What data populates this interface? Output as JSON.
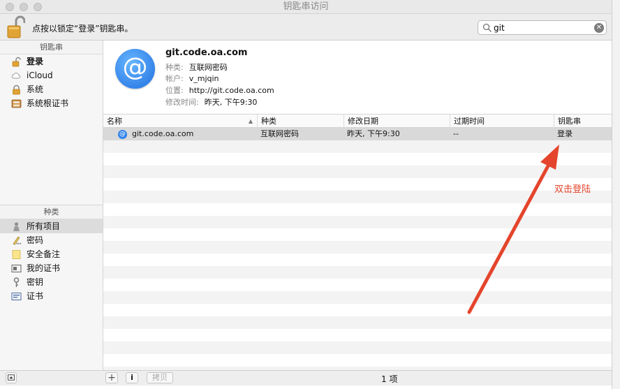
{
  "window": {
    "title": "钥匙串访问"
  },
  "toolbar": {
    "lock_hint": "点按以锁定“登录”钥匙串。",
    "search": {
      "value": "git"
    }
  },
  "sidebar": {
    "keychains_header": "钥匙串",
    "keychains": [
      {
        "label": "登录",
        "icon": "lock-icon",
        "bold": true
      },
      {
        "label": "iCloud",
        "icon": "cloud-icon"
      },
      {
        "label": "系统",
        "icon": "lock-icon"
      },
      {
        "label": "系统根证书",
        "icon": "certificate-cabinet-icon"
      }
    ],
    "categories_header": "种类",
    "categories": [
      {
        "label": "所有项目",
        "icon": "all-items-icon",
        "selected": true
      },
      {
        "label": "密码",
        "icon": "password-pen-icon"
      },
      {
        "label": "安全备注",
        "icon": "note-icon"
      },
      {
        "label": "我的证书",
        "icon": "my-certificate-icon"
      },
      {
        "label": "密钥",
        "icon": "key-icon"
      },
      {
        "label": "证书",
        "icon": "certificate-icon"
      }
    ]
  },
  "detail": {
    "title": "git.code.oa.com",
    "kind_label": "种类:",
    "kind_value": "互联网密码",
    "account_label": "帐户:",
    "account_value": "v_mjqin",
    "where_label": "位置:",
    "where_value": "http://git.code.oa.com",
    "modified_label": "修改时间:",
    "modified_value": "昨天, 下午9:30"
  },
  "table": {
    "columns": [
      "名称",
      "种类",
      "修改日期",
      "过期时间",
      "钥匙串"
    ],
    "rows": [
      {
        "name": "git.code.oa.com",
        "kind": "互联网密码",
        "modified": "昨天, 下午9:30",
        "expires": "--",
        "keychain": "登录"
      }
    ]
  },
  "bottom": {
    "add": "+",
    "info": "i",
    "copy": "拷贝",
    "count": "1 项"
  },
  "annotation": {
    "text": "双击登陆",
    "color": "#e4452c"
  },
  "colors": {
    "accent": "#2f82ea",
    "annotation": "#e4452c"
  }
}
